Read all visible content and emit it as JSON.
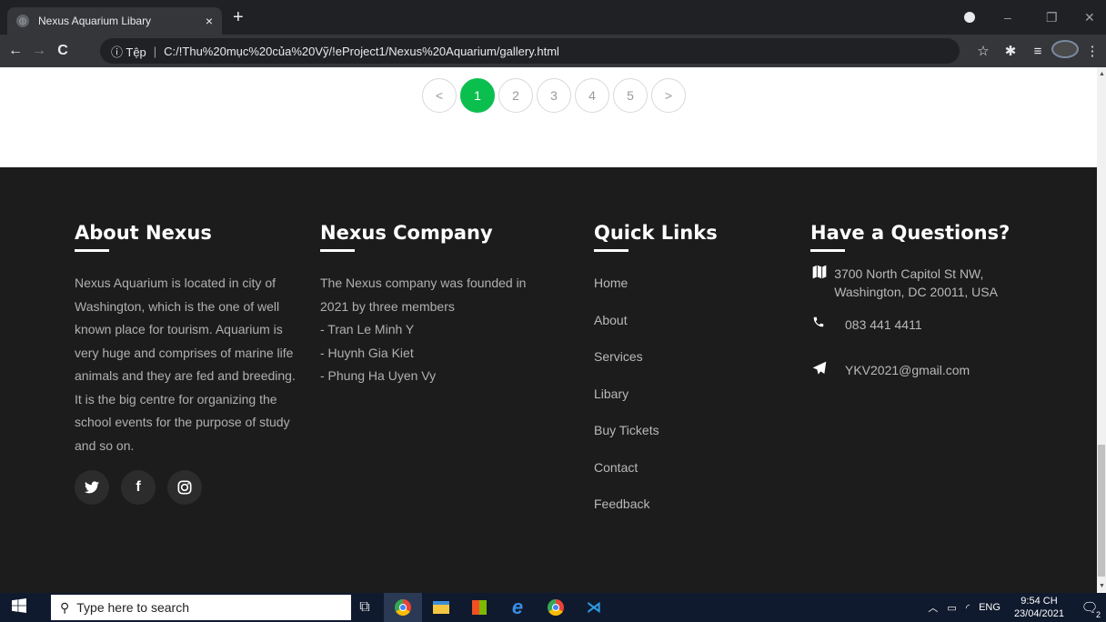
{
  "browser": {
    "tab_title": "Nexus Aquarium Libary",
    "tab_close": "×",
    "new_tab": "+",
    "url_security": "ⓘ Tệp",
    "url": "C:/!Thu%20mục%20của%20Vỹ/!eProject1/Nexus%20Aquarium/gallery.html",
    "back": "←",
    "forward": "→",
    "reload": "C",
    "star": "☆",
    "minimize": "–",
    "maximize": "❐",
    "close": "✕"
  },
  "pagination": {
    "prev": "<",
    "pages": [
      "1",
      "2",
      "3",
      "4",
      "5"
    ],
    "next": ">",
    "active_page": "1",
    "active_color": "#0bbf4f"
  },
  "footer": {
    "about": {
      "title": "About Nexus",
      "text": "Nexus Aquarium is located in city of Washington, which is the one of well known place for tourism. Aquarium is very huge and comprises of marine life animals and they are fed and breeding. It is the big centre for organizing the school events for the purpose of study and so on.",
      "social": [
        {
          "icon": "twitter-icon",
          "glyph": "🐦"
        },
        {
          "icon": "facebook-icon",
          "glyph": "f"
        },
        {
          "icon": "instagram-icon",
          "glyph": "◎"
        }
      ]
    },
    "company": {
      "title": "Nexus Company",
      "line1": "The Nexus company was founded in 2021 by three members",
      "line2": "- Tran Le Minh Y",
      "line3": "- Huynh Gia Kiet",
      "line4": "- Phung Ha Uyen Vy"
    },
    "links": {
      "title": "Quick Links",
      "items": [
        "Home",
        "About",
        "Services",
        "Libary",
        "Buy Tickets",
        "Contact",
        "Feedback"
      ]
    },
    "contact": {
      "title": "Have a Questions?",
      "address": "3700 North Capitol St NW, Washington, DC 20011, USA",
      "phone": "083 441 4411",
      "email": "YKV2021@gmail.com"
    }
  },
  "taskbar": {
    "search_placeholder": "Type here to search",
    "lang": "ENG",
    "time": "9:54 CH",
    "date": "23/04/2021",
    "notif_count": "2"
  }
}
